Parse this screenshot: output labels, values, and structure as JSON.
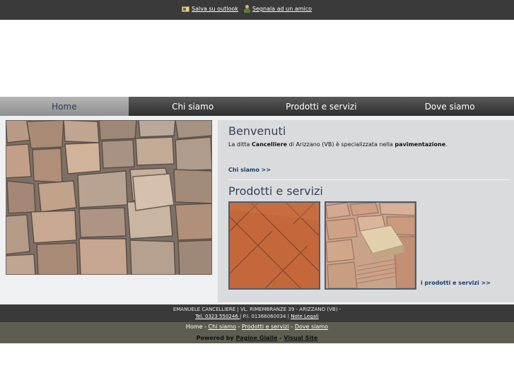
{
  "top_links": {
    "outlook_label": "Salva su outlook",
    "friend_label": "Segnala ad un amico"
  },
  "nav": {
    "items": [
      {
        "label": "Home"
      },
      {
        "label": "Chi siamo"
      },
      {
        "label": "Prodotti e servizi"
      },
      {
        "label": "Dove siamo"
      }
    ]
  },
  "welcome": {
    "title": "Benvenuti",
    "text_pre": "La ditta ",
    "text_bold1": "Cancelliere",
    "text_mid": " di Arizzano (VB) è specializzata nella ",
    "text_bold2": "pavimentazione",
    "text_end": ".",
    "more_link": "Chi siamo >>"
  },
  "products": {
    "title": "Prodotti e servizi",
    "more_link": "i prodotti e servizi >>"
  },
  "footer": {
    "address": "EMANUELE CANCELLIERE | VL. RIMEMBRANZE 39 - ARIZZANO (VB) -",
    "phone": "Tel. 0323 550246 ",
    "vat": " | P.I. 01366060034 | ",
    "legal": "Note Legali",
    "nav_home": "Home",
    "nav_chi": "Chi siamo",
    "nav_prodotti": "Prodotti e servizi",
    "nav_dove": "Dove siamo",
    "sep": " - ",
    "powered_label": "Powered by ",
    "pagine_gialle": "Pagine Gialle",
    "dash": " - ",
    "visual_site": "Visual Site"
  },
  "colors": {
    "topbar": "#3a3a3a",
    "nav_active": "#a3a3a3",
    "content_panel": "#d9dbdd",
    "title": "#3b4256",
    "link": "#1d3c6e"
  }
}
